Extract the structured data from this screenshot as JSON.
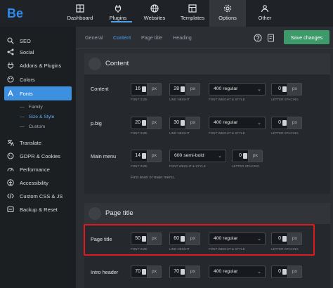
{
  "brand": {
    "logo_text": "Be"
  },
  "topnav": [
    {
      "label": "Dashboard",
      "icon": "grid-icon"
    },
    {
      "label": "Plugins",
      "icon": "plug-icon"
    },
    {
      "label": "Websites",
      "icon": "globe-icon"
    },
    {
      "label": "Templates",
      "icon": "template-icon"
    },
    {
      "label": "Options",
      "icon": "gear-icon",
      "active": true
    },
    {
      "label": "Other",
      "icon": "people-icon"
    }
  ],
  "sidebar": {
    "items": [
      {
        "label": "SEO",
        "icon": "seo-icon"
      },
      {
        "label": "Social",
        "icon": "share-icon"
      },
      {
        "label": "Addons & Plugins",
        "icon": "plug-icon"
      },
      {
        "label": "Colors",
        "icon": "palette-icon"
      },
      {
        "label": "Fonts",
        "icon": "font-icon",
        "active": true
      },
      {
        "label": "Translate",
        "icon": "translate-icon"
      },
      {
        "label": "GDPR & Cookies",
        "icon": "cookie-icon"
      },
      {
        "label": "Performance",
        "icon": "speed-icon"
      },
      {
        "label": "Accessibility",
        "icon": "accessibility-icon"
      },
      {
        "label": "Custom CSS & JS",
        "icon": "code-icon"
      },
      {
        "label": "Backup & Reset",
        "icon": "backup-icon"
      }
    ],
    "subitems": [
      {
        "label": "Family"
      },
      {
        "label": "Size & Style",
        "active": true
      },
      {
        "label": "Custom"
      }
    ]
  },
  "tabs": [
    {
      "label": "General"
    },
    {
      "label": "Content",
      "active": true
    },
    {
      "label": "Page title"
    },
    {
      "label": "Heading"
    }
  ],
  "header_actions": {
    "save_label": "Save changes"
  },
  "sections": {
    "content": {
      "title": "Content"
    },
    "page_title": {
      "title": "Page title"
    }
  },
  "labels": {
    "font_size": "FONT SIZE",
    "line_height": "LINE HEIGHT",
    "font_weight_style": "FONT WEIGHT & STYLE",
    "letter_spacing": "LETTER SPACING",
    "px": "px"
  },
  "rows": {
    "content": {
      "label": "Content",
      "font_size": "16",
      "line_height": "28",
      "weight": "400 regular",
      "letter_spacing": "0"
    },
    "pbig": {
      "label": "p.big",
      "font_size": "20",
      "line_height": "30",
      "weight": "400 regular",
      "letter_spacing": "0"
    },
    "main_menu": {
      "label": "Main menu",
      "font_size": "14",
      "weight": "600 semi-bold",
      "letter_spacing": "0",
      "note": "First level of main menu."
    },
    "page_title": {
      "label": "Page title",
      "font_size": "50",
      "line_height": "60",
      "weight": "400 regular",
      "letter_spacing": "0"
    },
    "intro_header": {
      "label": "Intro header",
      "font_size": "70",
      "line_height": "70",
      "weight": "400 regular",
      "letter_spacing": "0"
    }
  },
  "colors": {
    "accent": "#3d8fe0",
    "save": "#3d9a6a",
    "highlight": "#e0191f"
  }
}
